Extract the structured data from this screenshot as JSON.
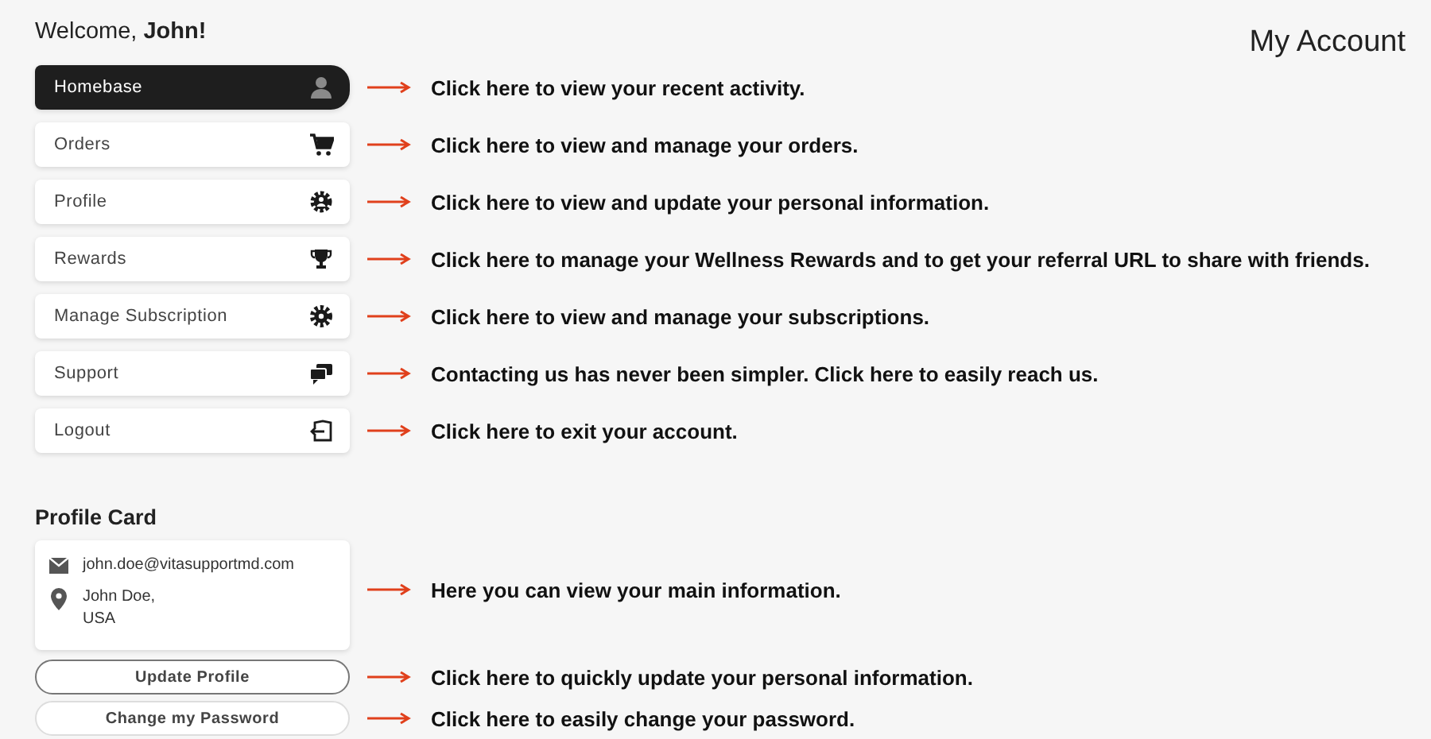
{
  "welcome": {
    "greeting": "Welcome, ",
    "name": "John!"
  },
  "page_title": "My Account",
  "menu": [
    {
      "label": "Homebase",
      "selected": true,
      "note": "Click here to view your recent activity."
    },
    {
      "label": "Orders",
      "selected": false,
      "note": "Click here to view and manage your orders."
    },
    {
      "label": "Profile",
      "selected": false,
      "note": "Click here to view and update your personal information."
    },
    {
      "label": "Rewards",
      "selected": false,
      "note": "Click here to manage your Wellness Rewards and to get your referral URL to share with friends."
    },
    {
      "label": "Manage Subscription",
      "selected": false,
      "note": "Click here to view and manage your subscriptions."
    },
    {
      "label": "Support",
      "selected": false,
      "note": "Contacting us has never been simpler. Click here to easily reach us."
    },
    {
      "label": "Logout",
      "selected": false,
      "note": "Click here to exit your account."
    }
  ],
  "profile_card": {
    "title": "Profile Card",
    "email": "john.doe@vitasupportmd.com",
    "address": [
      "John Doe,",
      "USA"
    ],
    "note": "Here you can view your main information."
  },
  "buttons": [
    {
      "label": "Update Profile",
      "note": "Click here to quickly update your personal information."
    },
    {
      "label": "Change my Password",
      "note": "Click here to easily change your password."
    }
  ]
}
